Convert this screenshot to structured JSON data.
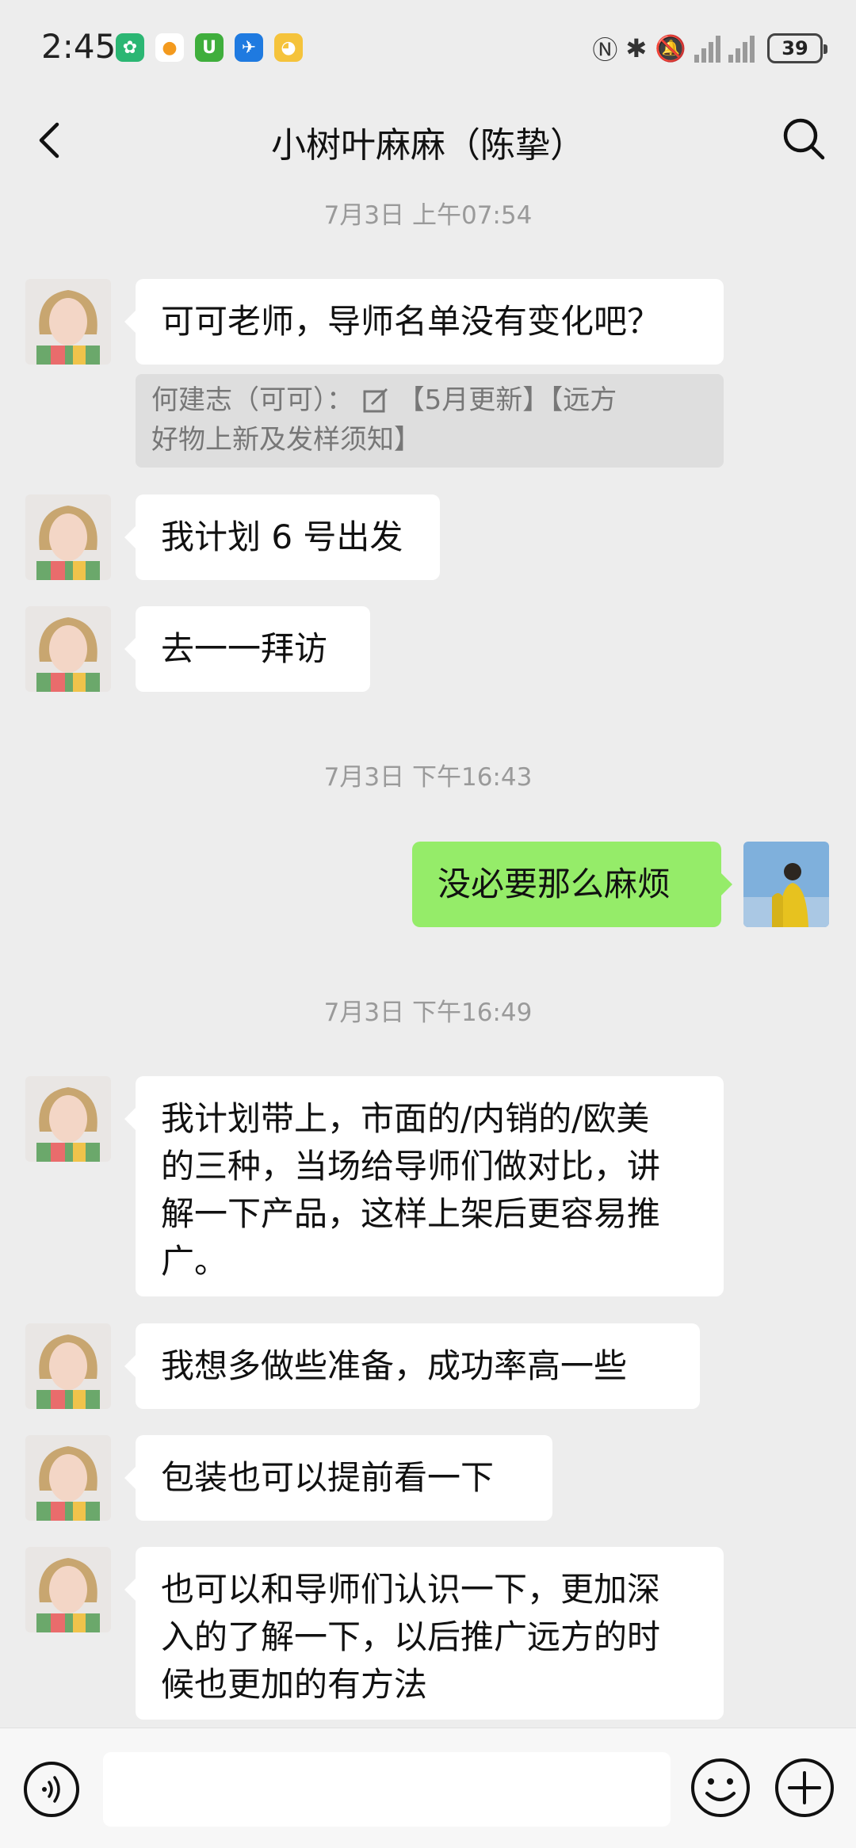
{
  "status_bar": {
    "time": "2:45",
    "battery": "39"
  },
  "header": {
    "title": "小树叶麻麻（陈挚）"
  },
  "messages": {
    "ts1": "7月3日 上午07:54",
    "m1": "可可老师，导师名单没有变化吧？",
    "quote_sender": "何建志（可可）：",
    "quote_text_a": "【5月更新】【远方",
    "quote_text_b": "好物上新及发样须知】",
    "m2": "我计划 6 号出发",
    "m3": "去一一拜访",
    "ts2": "7月3日 下午16:43",
    "m4": "没必要那么麻烦",
    "ts3": "7月3日 下午16:49",
    "m5_l1": "我计划带上，市面的/内销的/欧美",
    "m5_l2": "的三种，当场给导师们做对比，讲",
    "m5_l3": "解一下产品，这样上架后更容易推",
    "m5_l4": "广。",
    "m6": "我想多做些准备，成功率高一些",
    "m7": "包装也可以提前看一下",
    "m8_l1": "也可以和导师们认识一下，更加深",
    "m8_l2": "入的了解一下，以后推广远方的时",
    "m8_l3": "候也更加的有方法"
  },
  "input": {
    "placeholder": ""
  },
  "icons": {
    "app_icons": [
      "green-leaf-app-icon",
      "orange-app-icon",
      "green-u-app-icon",
      "blue-plane-app-icon",
      "yellow-duck-app-icon"
    ],
    "system": [
      "nfc-icon",
      "bluetooth-icon",
      "mute-icon",
      "signal-icon",
      "battery-icon"
    ]
  },
  "colors": {
    "outgoing_bubble": "#95ec69",
    "background": "#ededed"
  }
}
